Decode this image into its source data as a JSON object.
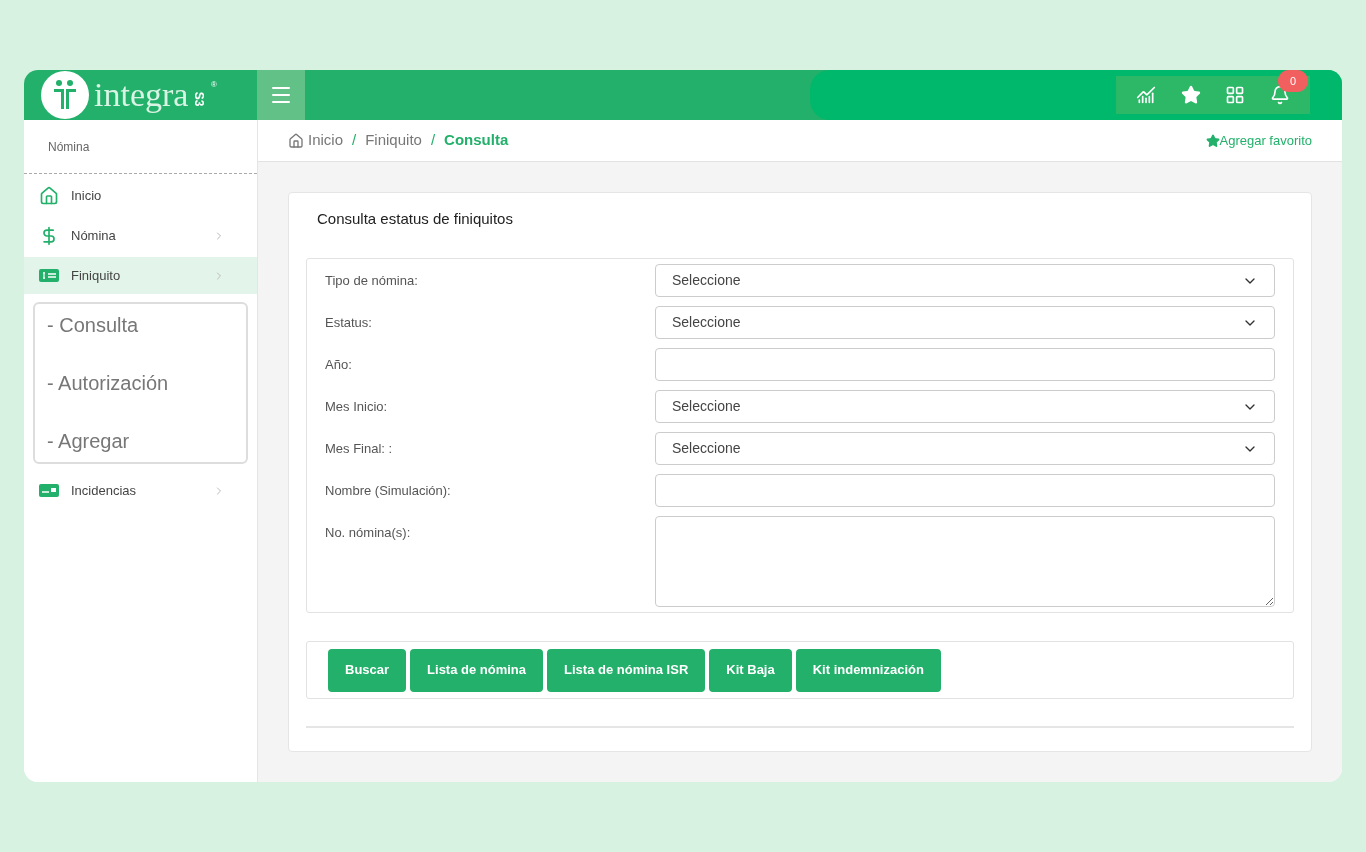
{
  "logo": {
    "name": "integra",
    "suffix": "S3",
    "mark": "®"
  },
  "header": {
    "notifications": "0"
  },
  "sidebar": {
    "section": "Nómina",
    "items": [
      {
        "label": "Inicio",
        "kind": "home",
        "selected": false,
        "expandable": false
      },
      {
        "label": "Nómina",
        "kind": "dollar",
        "selected": false,
        "expandable": true
      },
      {
        "label": "Finiquito",
        "kind": "bill",
        "selected": true,
        "expandable": true,
        "expanded": true,
        "children": [
          {
            "label": "- Consulta"
          },
          {
            "label": "- Autorización"
          },
          {
            "label": "- Agregar"
          }
        ]
      },
      {
        "label": "Incidencias",
        "kind": "card",
        "selected": false,
        "expandable": true
      }
    ]
  },
  "breadcrumb": [
    {
      "label": "Inicio",
      "selected": false
    },
    {
      "label": "Finiquito",
      "selected": false
    },
    {
      "label": "Consulta",
      "selected": true
    }
  ],
  "breadcrumb_separator": "/",
  "favorite": "Agregar favorito",
  "card": {
    "title": "Consulta estatus de finiquitos",
    "fields": [
      {
        "label": "Tipo de nómina:",
        "kind": "select",
        "value": "Seleccione"
      },
      {
        "label": "Estatus:",
        "kind": "select",
        "value": "Seleccione"
      },
      {
        "label": "Año:",
        "kind": "input"
      },
      {
        "label": "Mes Inicio:",
        "kind": "select",
        "value": "Seleccione"
      },
      {
        "label": "Mes Final: :",
        "kind": "select",
        "value": "Seleccione"
      },
      {
        "label": "Nombre (Simulación):",
        "kind": "input"
      },
      {
        "label": "No. nómina(s):",
        "kind": "textarea"
      }
    ],
    "buttons": [
      "Buscar",
      "Lista de nómina",
      "Lista de nómina ISR",
      "Kit Baja",
      "Kit indemnización"
    ]
  }
}
